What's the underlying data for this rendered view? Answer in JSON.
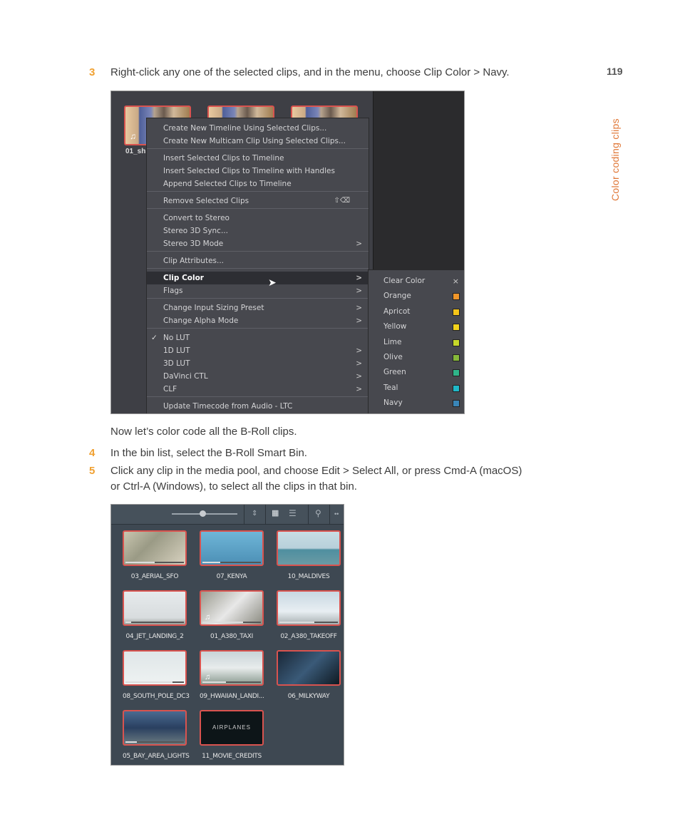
{
  "page": {
    "number": "119",
    "section_title": "Color coding clips"
  },
  "steps": [
    {
      "num": "3",
      "text": "Right-click any one of the selected clips, and in the menu, choose Clip Color > Navy."
    },
    {
      "num": "4",
      "text": "In the bin list, select the B-Roll Smart Bin."
    },
    {
      "num": "5",
      "text_line1": "Click any clip in the media pool, and choose Edit > Select All, or press Cmd-A (macOS)",
      "text_line2": "or Ctrl-A (Windows), to select all the clips in that bin."
    }
  ],
  "interlude": "Now let’s color code all the B-Roll clips.",
  "screenshot1": {
    "clip_label": "01_sh",
    "context_menu": [
      {
        "label": "Create New Timeline Using Selected Clips..."
      },
      {
        "label": "Create New Multicam Clip Using Selected Clips..."
      },
      {
        "label": "Insert Selected Clips to Timeline"
      },
      {
        "label": "Insert Selected Clips to Timeline with Handles"
      },
      {
        "label": "Append Selected Clips to Timeline"
      },
      {
        "label": "Remove Selected Clips",
        "shortcut": "⇧⌫"
      },
      {
        "label": "Convert to Stereo"
      },
      {
        "label": "Stereo 3D Sync..."
      },
      {
        "label": "Stereo 3D Mode",
        "submenu": true
      },
      {
        "label": "Clip Attributes..."
      },
      {
        "label": "Clip Color",
        "submenu": true,
        "highlighted": true
      },
      {
        "label": "Flags",
        "submenu": true
      },
      {
        "label": "Change Input Sizing Preset",
        "submenu": true
      },
      {
        "label": "Change Alpha Mode",
        "submenu": true
      },
      {
        "label": "No LUT",
        "checked": true
      },
      {
        "label": "1D LUT",
        "submenu": true
      },
      {
        "label": "3D LUT",
        "submenu": true
      },
      {
        "label": "DaVinci CTL",
        "submenu": true
      },
      {
        "label": "CLF",
        "submenu": true
      },
      {
        "label": "Update Timecode from Audio - LTC"
      }
    ],
    "arrow_glyph": ">",
    "check_glyph": "✓",
    "clip_color_submenu": [
      {
        "label": "Clear Color",
        "icon": "×"
      },
      {
        "label": "Orange",
        "color": "#f0962a"
      },
      {
        "label": "Apricot",
        "color": "#f5c518"
      },
      {
        "label": "Yellow",
        "color": "#f2d21c"
      },
      {
        "label": "Lime",
        "color": "#c6d82a"
      },
      {
        "label": "Olive",
        "color": "#86b83a"
      },
      {
        "label": "Green",
        "color": "#2fb58a"
      },
      {
        "label": "Teal",
        "color": "#1fb8c8"
      },
      {
        "label": "Navy",
        "color": "#3a86b8"
      }
    ]
  },
  "screenshot2": {
    "clips": [
      {
        "name": "03_AERIAL_SFO",
        "bg": "linear-gradient(135deg,#c9c6b0,#9a9a85 40%,#d8d2c0)",
        "progress": 0.5,
        "audio": false
      },
      {
        "name": "07_KENYA",
        "bg": "linear-gradient(180deg,#6fb6d8,#4c8fb5)",
        "progress": 0.3,
        "audio": false
      },
      {
        "name": "10_MALDIVES",
        "bg": "linear-gradient(180deg,#c8dde4 0%,#b8d0da 50%,#4f8fa0 55%,#6a9aa4 100%)",
        "progress": 0,
        "audio": false
      },
      {
        "name": "04_JET_LANDING_2",
        "bg": "linear-gradient(180deg,#e6eaec,#d8dcde 80%,#9aa09a)",
        "progress": 0.1,
        "audio": false
      },
      {
        "name": "01_A380_TAXI",
        "bg": "linear-gradient(135deg,#9a9a8e,#e8e8e8 50%,#8a8a80)",
        "progress": 0.7,
        "audio": true
      },
      {
        "name": "02_A380_TAKEOFF",
        "bg": "linear-gradient(180deg,#c8d8e2,#e8eef2 60%,#a8b0b2)",
        "progress": 0.6,
        "audio": false
      },
      {
        "name": "08_SOUTH_POLE_DC3",
        "bg": "linear-gradient(180deg,#dfe6e8,#eef2f2)",
        "progress": 0.8,
        "audio": false
      },
      {
        "name": "09_HWAIIAN_LANDI...",
        "bg": "linear-gradient(180deg,#c8d4d8,#e8ecec 50%,#8a9a90)",
        "progress": 0.4,
        "audio": true
      },
      {
        "name": "06_MILKYWAY",
        "bg": "linear-gradient(135deg,#1a2838,#3a5a78 50%,#0f1a22)",
        "progress": 0,
        "audio": false
      },
      {
        "name": "05_BAY_AREA_LIGHTS",
        "bg": "linear-gradient(180deg,#4a6a90,#2a4060 50%,#6a7a80)",
        "progress": 0.2,
        "audio": false
      },
      {
        "name": "11_MOVIE_CREDITS",
        "bg": "#0d1518",
        "progress": 0,
        "audio": false,
        "overlay_text": "AIRPLANES"
      }
    ]
  }
}
